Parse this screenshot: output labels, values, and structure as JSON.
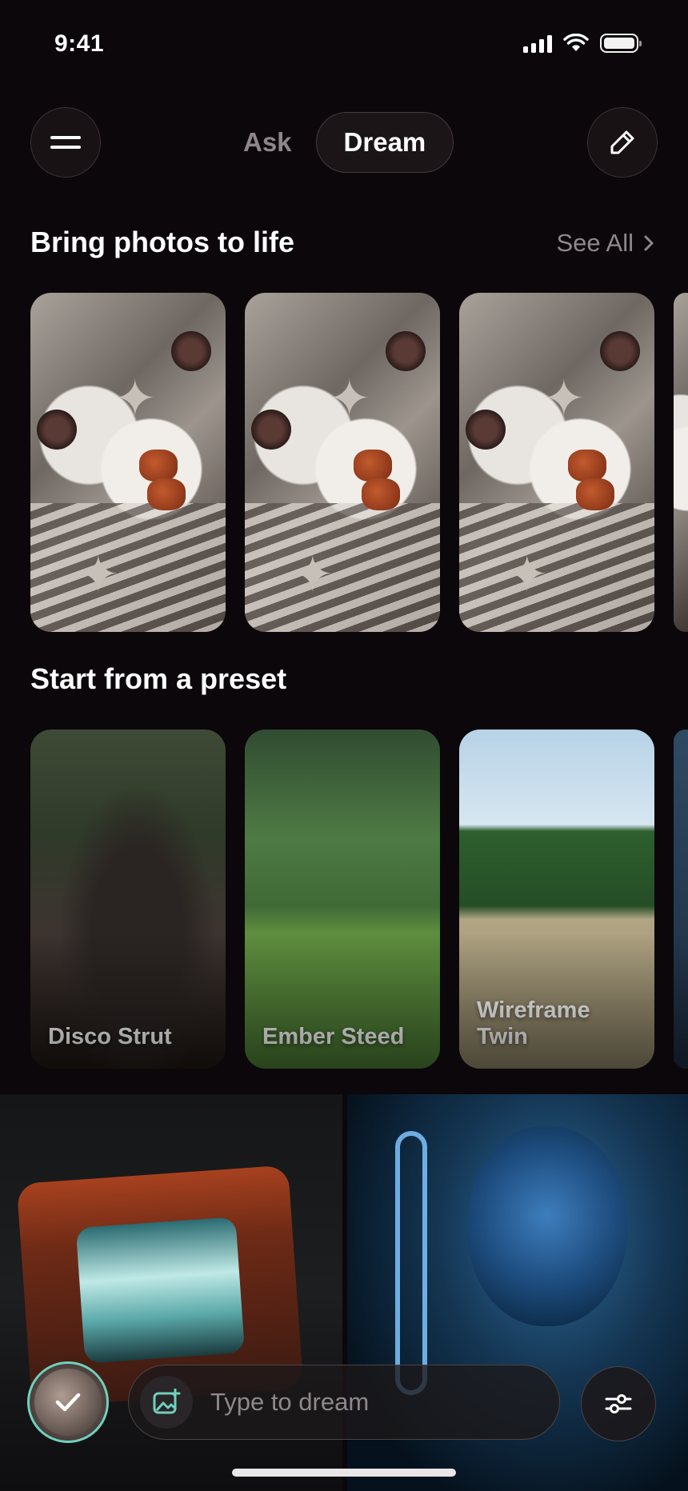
{
  "status_bar": {
    "time": "9:41"
  },
  "header": {
    "tabs": [
      {
        "label": "Ask",
        "selected": false
      },
      {
        "label": "Dream",
        "selected": true
      }
    ]
  },
  "sections": {
    "photos": {
      "title": "Bring photos to life",
      "see_all": "See All"
    },
    "presets": {
      "title": "Start from a preset"
    }
  },
  "presets": [
    {
      "label": "Disco Strut"
    },
    {
      "label": "Ember Steed"
    },
    {
      "label": "Wireframe Twin"
    }
  ],
  "composer": {
    "placeholder": "Type to dream"
  },
  "colors": {
    "background": "#0c070a",
    "accent_ring": "#6fd0bd"
  }
}
